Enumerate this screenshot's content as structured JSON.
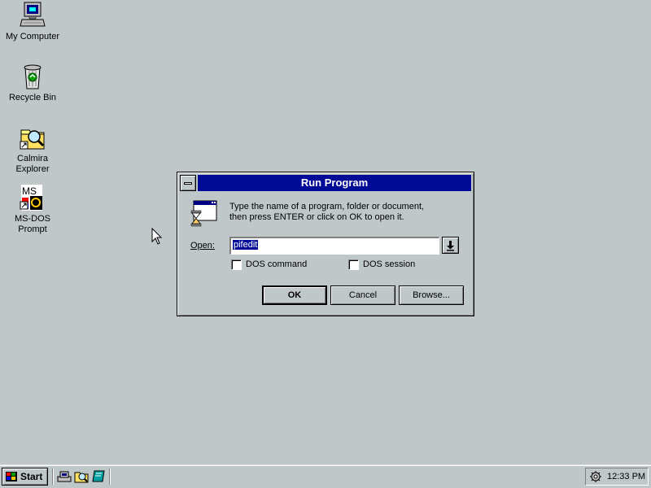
{
  "desktop": {
    "icons": [
      {
        "label": "My Computer",
        "icon": "my-computer-icon"
      },
      {
        "label": "Recycle Bin",
        "icon": "recycle-bin-icon"
      },
      {
        "label": "Calmira\nExplorer",
        "icon": "calmira-explorer-icon"
      },
      {
        "label": "MS-DOS\nPrompt",
        "icon": "ms-dos-prompt-icon"
      }
    ]
  },
  "dialog": {
    "title": "Run Program",
    "prompt_line1": "Type the name of a program, folder or document,",
    "prompt_line2": "then press ENTER or click on OK to open it.",
    "open_label": "Open:",
    "open_value": "pifedit",
    "checkboxes": {
      "dos_command": {
        "label": "DOS command",
        "checked": false
      },
      "dos_session": {
        "label": "DOS session",
        "checked": false
      }
    },
    "buttons": {
      "ok": "OK",
      "cancel": "Cancel",
      "browse": "Browse..."
    }
  },
  "taskbar": {
    "start_label": "Start",
    "quick_launch": [
      "quick-launch-explorer-icon",
      "quick-launch-find-icon",
      "quick-launch-book-icon"
    ],
    "clock": "12:33 PM"
  },
  "colors": {
    "desktop": "#c0c7c8",
    "titlebar": "#000a96",
    "selection": "#000a96"
  }
}
